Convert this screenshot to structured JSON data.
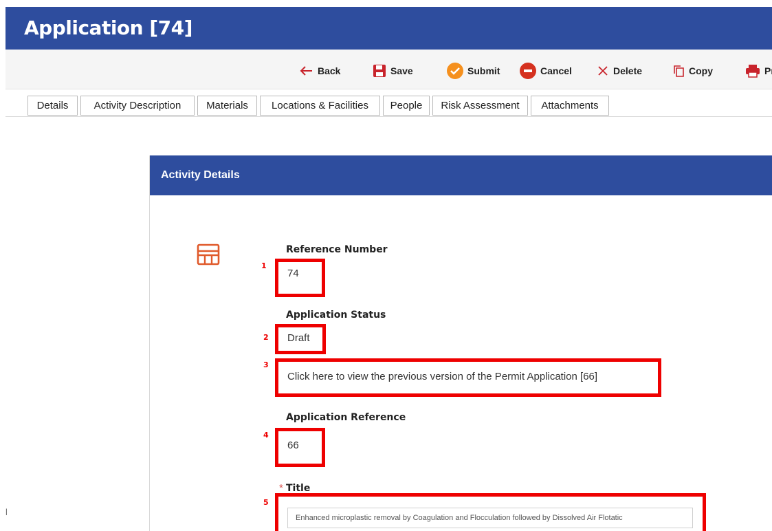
{
  "header": {
    "title": "Application [74]"
  },
  "toolbar": {
    "back": "Back",
    "save": "Save",
    "submit": "Submit",
    "cancel": "Cancel",
    "delete": "Delete",
    "copy": "Copy",
    "print": "Pr"
  },
  "tabs": [
    "Details",
    "Activity Description",
    "Materials",
    "Locations & Facilities",
    "People",
    "Risk Assessment",
    "Attachments"
  ],
  "panel": {
    "title": "Activity Details"
  },
  "fields": {
    "reference_number": {
      "label": "Reference Number",
      "value": "74"
    },
    "application_status": {
      "label": "Application Status",
      "value": "Draft"
    },
    "previous_version_link": "Click here to view the previous version of the Permit Application [66]",
    "application_reference": {
      "label": "Application Reference",
      "value": "66"
    },
    "title": {
      "label": "Title",
      "required_marker": "*",
      "value": "Enhanced microplastic removal by Coagulation and Flocculation followed by Dissolved Air Flotatic"
    }
  },
  "annotations": [
    "1",
    "2",
    "3",
    "4",
    "5"
  ],
  "edge_mark": "l",
  "colors": {
    "brand_blue": "#2e4d9e",
    "highlight_red": "#ee0000",
    "icon_orange": "#e05a2b",
    "submit_orange": "#f5901e",
    "cancel_red": "#d5311f",
    "save_red": "#c8232b",
    "print_red": "#c8232b"
  }
}
